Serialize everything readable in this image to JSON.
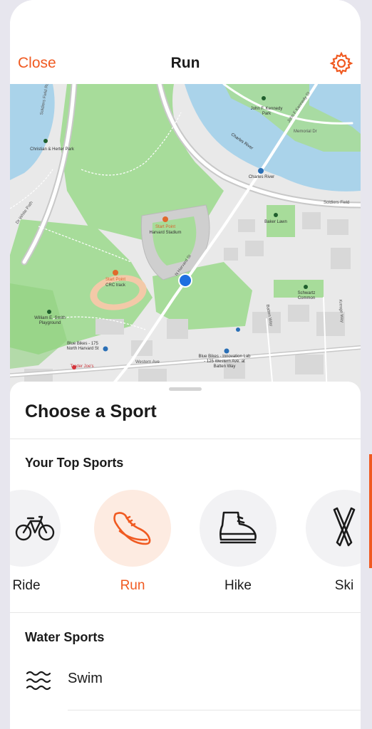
{
  "header": {
    "close_label": "Close",
    "title": "Run",
    "settings_icon": "gear-icon"
  },
  "map": {
    "labels": {
      "christian_herter": "Christian & Herter Park",
      "john_kennedy": "John F. Kennedy Park",
      "charles_river": "Charles River",
      "charles_river_water": "Charles River",
      "start_point_stadium": "Start Point",
      "harvard_stadium": "Harvard Stadium",
      "start_point_track": "Start Point",
      "crc_track": "CRC track",
      "baker_lawn": "Baker Lawn",
      "schwartz_common": "Schwartz Common",
      "william_smith": "William E. Smith Playground",
      "blue_bikes_north_harvard": "Blue Bikes - 175 North Harvard St",
      "blue_bikes_innovation": "Blue Bikes - Innovation Lab - 125 Western Ave. at Batten Way",
      "trader_joes": "Trader Joe's",
      "soldiers_field": "Soldiers Field",
      "memorial_dr": "Memorial Dr",
      "jfk_st": "John F Kennedy St",
      "north_harvard_st": "N Harvard St",
      "western_ave": "Western Ave",
      "kresge_way": "Kresge Way",
      "batten_way": "Batten Way",
      "white_path": "Dr White Path",
      "soldiers_field_rd": "Soldiers Field Rd"
    }
  },
  "sheet": {
    "title": "Choose a Sport",
    "top_sports_title": "Your Top Sports",
    "sports": [
      {
        "label": "Ride",
        "icon": "bicycle-icon",
        "selected": false
      },
      {
        "label": "Run",
        "icon": "running-shoe-icon",
        "selected": true
      },
      {
        "label": "Hike",
        "icon": "hiking-boot-icon",
        "selected": false
      },
      {
        "label": "Ski",
        "icon": "skis-icon",
        "selected": false
      }
    ],
    "water_sports_title": "Water Sports",
    "water_sports": [
      {
        "label": "Swim",
        "icon": "waves-icon"
      }
    ]
  },
  "colors": {
    "accent": "#f05a21",
    "selected_bg": "#fdebe1",
    "circle_bg": "#f2f2f4",
    "park_green": "#a7dc9a",
    "water_blue": "#aad3ea",
    "user_location": "#1e6fe0"
  }
}
